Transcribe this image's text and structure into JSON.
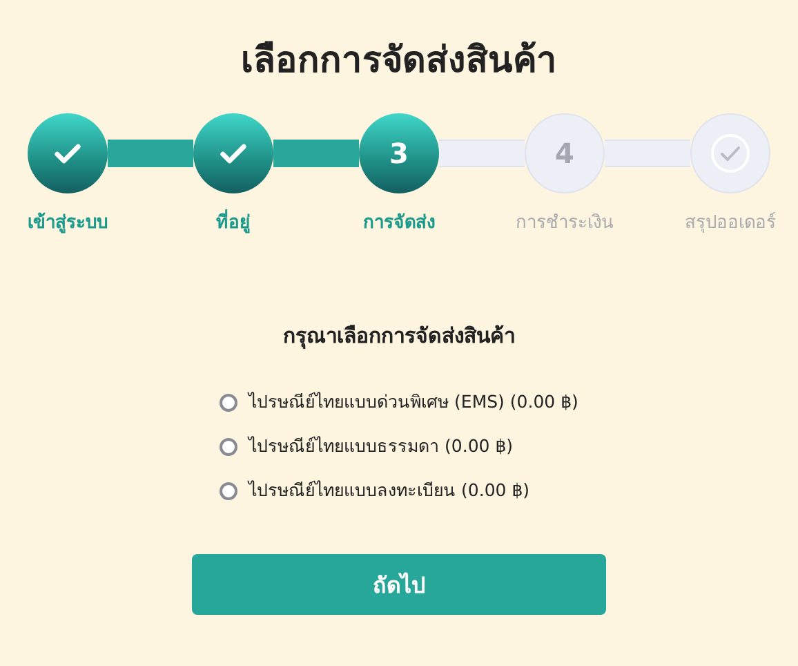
{
  "title": "เลือกการจัดส่งสินค้า",
  "steps": [
    {
      "label": "เข้าสู่ระบบ",
      "kind": "done"
    },
    {
      "label": "ที่อยู่",
      "kind": "done"
    },
    {
      "label": "การจัดส่ง",
      "kind": "current",
      "number": "3"
    },
    {
      "label": "การชำระเงิน",
      "kind": "pending",
      "number": "4"
    },
    {
      "label": "สรุปออเดอร์",
      "kind": "pending"
    }
  ],
  "shipping": {
    "heading": "กรุณาเลือกการจัดส่งสินค้า",
    "options": [
      {
        "label": "ไปรษณีย์ไทยแบบด่วนพิเศษ (EMS) (0.00 ฿)",
        "selected": false
      },
      {
        "label": "ไปรษณีย์ไทยแบบธรรมดา (0.00 ฿)",
        "selected": false
      },
      {
        "label": "ไปรษณีย์ไทยแบบลงทะเบียน (0.00 ฿)",
        "selected": false
      }
    ]
  },
  "next_button": "ถัดไป"
}
